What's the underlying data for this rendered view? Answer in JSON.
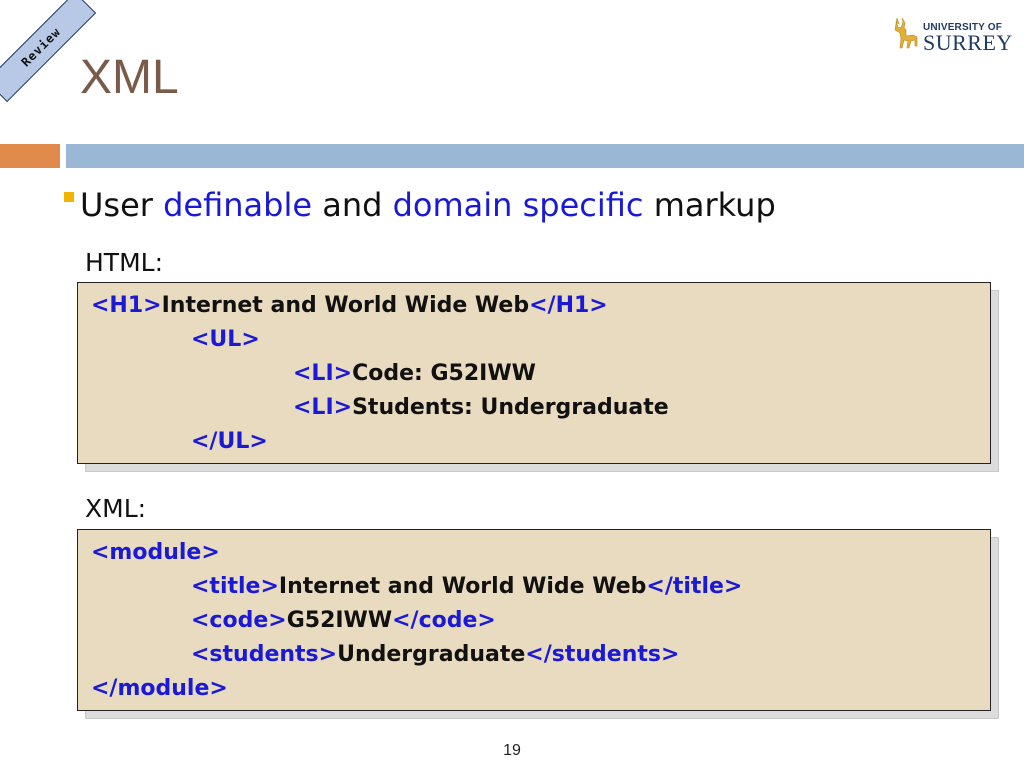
{
  "ribbon": {
    "text": "Review"
  },
  "slide_title": "XML",
  "logo": {
    "line1": "UNIVERSITY OF",
    "line2": "SURREY"
  },
  "bullet": {
    "parts": [
      "User ",
      "definable",
      " and ",
      "domain specific",
      " markup"
    ]
  },
  "html_section": {
    "label": "HTML:",
    "lines": [
      {
        "open": "<H1>",
        "text": "Internet and World Wide Web",
        "close": "</H1>"
      },
      {
        "open": "<UL>",
        "text": "",
        "close": ""
      },
      {
        "open": "<LI>",
        "text": "Code: G52IWW",
        "close": ""
      },
      {
        "open": "<LI>",
        "text": "Students: Undergraduate",
        "close": ""
      },
      {
        "open": "</UL>",
        "text": "",
        "close": ""
      }
    ]
  },
  "xml_section": {
    "label": "XML:",
    "lines": [
      {
        "open": "<module>",
        "text": "",
        "close": ""
      },
      {
        "open": "<title>",
        "text": "Internet and World Wide Web",
        "close": "</title>"
      },
      {
        "open": "<code>",
        "text": "G52IWW",
        "close": "</code>"
      },
      {
        "open": "<students>",
        "text": "Undergraduate",
        "close": "</students>"
      },
      {
        "open": "</module>",
        "text": "",
        "close": ""
      }
    ]
  },
  "page_number": "19",
  "colors": {
    "title": "#7a5a48",
    "tag": "#1a1ad6",
    "box_fill": "#e8dbc0",
    "accent_orange": "#e08a4c",
    "accent_blue": "#9ab8d6"
  }
}
